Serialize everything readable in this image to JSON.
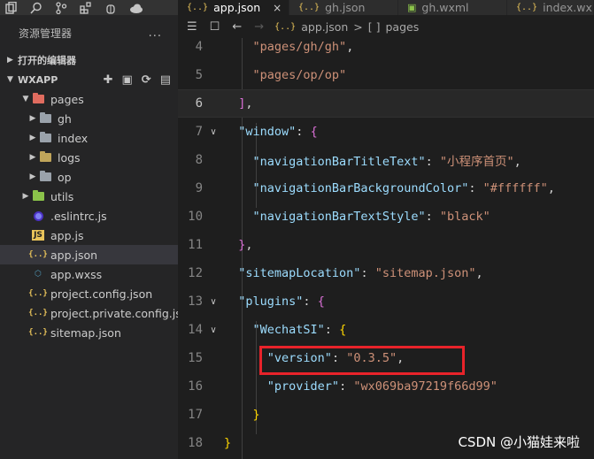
{
  "sidebar": {
    "title": "资源管理器",
    "more": "...",
    "open_editors": "打开的编辑器",
    "project": "WXAPP",
    "tree": [
      {
        "label": "pages",
        "kind": "folder-red",
        "depth": 1,
        "expanded": true
      },
      {
        "label": "gh",
        "kind": "folder",
        "depth": 2,
        "expanded": false
      },
      {
        "label": "index",
        "kind": "folder",
        "depth": 2,
        "expanded": false
      },
      {
        "label": "logs",
        "kind": "folder-yellow",
        "depth": 2,
        "expanded": false
      },
      {
        "label": "op",
        "kind": "folder",
        "depth": 2,
        "expanded": false
      },
      {
        "label": "utils",
        "kind": "folder-green",
        "depth": 1,
        "expanded": false
      },
      {
        "label": ".eslintrc.js",
        "kind": "eslint",
        "depth": 1
      },
      {
        "label": "app.js",
        "kind": "js",
        "depth": 1
      },
      {
        "label": "app.json",
        "kind": "json",
        "depth": 1,
        "selected": true
      },
      {
        "label": "app.wxss",
        "kind": "wxss",
        "depth": 1
      },
      {
        "label": "project.config.json",
        "kind": "json",
        "depth": 1
      },
      {
        "label": "project.private.config.js...",
        "kind": "json",
        "depth": 1
      },
      {
        "label": "sitemap.json",
        "kind": "json",
        "depth": 1
      }
    ]
  },
  "tabs": [
    {
      "label": "app.json",
      "icon": "{..}",
      "active": true,
      "close": "×"
    },
    {
      "label": "gh.json",
      "icon": "{..}",
      "active": false
    },
    {
      "label": "gh.wxml",
      "icon": "wxml",
      "active": false
    },
    {
      "label": "index.wx",
      "icon": "{..}",
      "active": false
    }
  ],
  "breadcrumb": {
    "file_icon": "{..}",
    "file": "app.json",
    "sep": ">",
    "node_icon": "[ ]",
    "node": "pages"
  },
  "editor": {
    "lines": [
      {
        "n": "4",
        "fold": "",
        "html": "    <span class='s'>\"pages/gh/gh\"</span><span class='p'>,</span>"
      },
      {
        "n": "5",
        "fold": "",
        "html": "    <span class='s'>\"pages/op/op\"</span>"
      },
      {
        "n": "6",
        "fold": "",
        "html": "  <span class='b1'>]</span><span class='p'>,</span>",
        "current": true
      },
      {
        "n": "7",
        "fold": "v",
        "html": "  <span class='k'>\"window\"</span><span class='p'>: </span><span class='b1'>{</span>"
      },
      {
        "n": "8",
        "fold": "",
        "html": "    <span class='k'>\"navigationBarTitleText\"</span><span class='p'>: </span><span class='s'>\"小程序首页\"</span><span class='p'>,</span>"
      },
      {
        "n": "9",
        "fold": "",
        "html": "    <span class='k'>\"navigationBarBackgroundColor\"</span><span class='p'>: </span><span class='s'>\"#ffffff\"</span><span class='p'>,</span>"
      },
      {
        "n": "10",
        "fold": "",
        "html": "    <span class='k'>\"navigationBarTextStyle\"</span><span class='p'>: </span><span class='s'>\"black\"</span>"
      },
      {
        "n": "11",
        "fold": "",
        "html": "  <span class='b1'>}</span><span class='p'>,</span>"
      },
      {
        "n": "12",
        "fold": "",
        "html": "  <span class='k'>\"sitemapLocation\"</span><span class='p'>: </span><span class='s'>\"sitemap.json\"</span><span class='p'>,</span>"
      },
      {
        "n": "13",
        "fold": "v",
        "html": "  <span class='k'>\"plugins\"</span><span class='p'>: </span><span class='b1'>{</span>"
      },
      {
        "n": "14",
        "fold": "v",
        "html": "    <span class='k'>\"WechatSI\"</span><span class='p'>: </span><span class='b2'>{</span>"
      },
      {
        "n": "15",
        "fold": "",
        "html": "      <span class='k'>\"version\"</span><span class='p'>: </span><span class='s'>\"0.3.5\"</span><span class='p'>,</span>"
      },
      {
        "n": "16",
        "fold": "",
        "html": "      <span class='k'>\"provider\"</span><span class='p'>: </span><span class='s'>\"wx069ba97219f66d99\"</span>"
      },
      {
        "n": "17",
        "fold": "",
        "html": "    <span class='b2'>}</span>"
      },
      {
        "n": "18",
        "fold": "",
        "html": "<span class='b2'>}</span>"
      }
    ]
  },
  "watermark": "CSDN @小猫娃来啦"
}
